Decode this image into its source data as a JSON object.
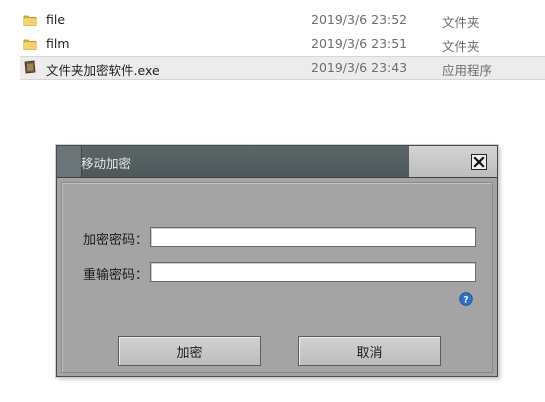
{
  "files": [
    {
      "name": "file",
      "date": "2019/3/6 23:52",
      "type": "文件夹",
      "icon": "folder-icon"
    },
    {
      "name": "film",
      "date": "2019/3/6 23:51",
      "type": "文件夹",
      "icon": "folder-icon"
    },
    {
      "name": "文件夹加密软件.exe",
      "date": "2019/3/6 23:43",
      "type": "应用程序",
      "icon": "application-icon"
    }
  ],
  "dialog": {
    "title": "移动加密",
    "encrypt_password_label": "加密密码：",
    "encrypt_password_value": "",
    "confirm_password_label": "重输密码：",
    "confirm_password_value": "",
    "encrypt_button": "加密",
    "cancel_button": "取消"
  },
  "colors": {
    "titlebar": "#56616a",
    "dialog_bg": "#a4a4a4",
    "help_icon": "#2f6fd0"
  }
}
